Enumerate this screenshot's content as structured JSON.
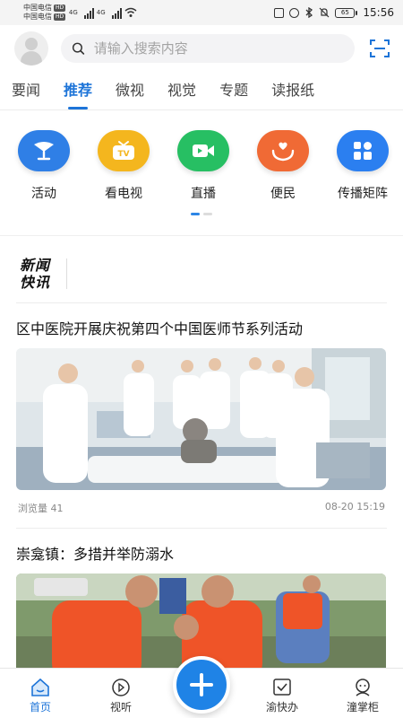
{
  "status_bar": {
    "carrier_1": "中国电信",
    "carrier_2": "中国电信",
    "hd_badge": "HD",
    "net_type": "4G",
    "battery": "65",
    "time": "15:56"
  },
  "search": {
    "placeholder": "请输入搜索内容"
  },
  "tabs": [
    {
      "label": "要闻",
      "active": false
    },
    {
      "label": "推荐",
      "active": true
    },
    {
      "label": "微视",
      "active": false
    },
    {
      "label": "视觉",
      "active": false
    },
    {
      "label": "专题",
      "active": false
    },
    {
      "label": "读报纸",
      "active": false
    }
  ],
  "shortcuts": [
    {
      "label": "活动",
      "icon": "activity-icon",
      "color": "#2f7fe6"
    },
    {
      "label": "看电视",
      "icon": "tv-icon",
      "color": "#f4b61e"
    },
    {
      "label": "直播",
      "icon": "video-camera-icon",
      "color": "#27bf63"
    },
    {
      "label": "便民",
      "icon": "heart-hand-icon",
      "color": "#f06a35"
    },
    {
      "label": "传播矩阵",
      "icon": "grid-icon",
      "color": "#2b7ff0"
    }
  ],
  "news_flash": {
    "logo_line1": "新闻",
    "logo_line2": "快讯"
  },
  "articles": [
    {
      "title": "区中医院开展庆祝第四个中国医师节系列活动",
      "views": "浏览量 41",
      "date": "08-20 15:19"
    },
    {
      "title": "崇龛镇：多措并举防溺水",
      "views": "",
      "date": ""
    }
  ],
  "bottom_nav": [
    {
      "label": "首页",
      "icon": "home-icon",
      "active": true
    },
    {
      "label": "视听",
      "icon": "play-icon",
      "active": false
    },
    {
      "label": "渝快办",
      "icon": "check-box-icon",
      "active": false
    },
    {
      "label": "潼掌柜",
      "icon": "assistant-icon",
      "active": false
    }
  ],
  "colors": {
    "accent": "#1d74d8",
    "fab": "#1f83e6"
  }
}
